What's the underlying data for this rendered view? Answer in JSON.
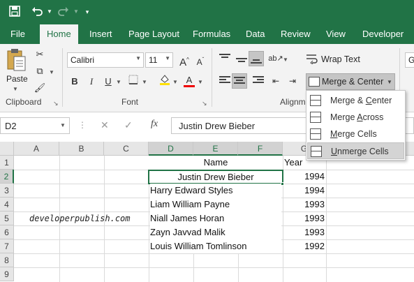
{
  "quick_access": {
    "save_icon": "save-icon",
    "undo_icon": "undo-icon",
    "redo_icon": "redo-icon",
    "customize_icon": "customize-icon"
  },
  "tabs": [
    "File",
    "Home",
    "Insert",
    "Page Layout",
    "Formulas",
    "Data",
    "Review",
    "View",
    "Developer"
  ],
  "active_tab": "Home",
  "ribbon": {
    "clipboard": {
      "paste_label": "Paste",
      "group_label": "Clipboard"
    },
    "font": {
      "font_name": "Calibri",
      "font_size": "11",
      "grow_label": "A",
      "shrink_label": "A",
      "bold": "B",
      "italic": "I",
      "underline": "U",
      "font_color_label": "A",
      "group_label": "Font"
    },
    "alignment": {
      "wrap_text": "Wrap Text",
      "merge_center": "Merge & Center",
      "group_label": "Alignm"
    },
    "number": {
      "format_value": "G"
    }
  },
  "formula_bar": {
    "name_box": "D2",
    "fx_label": "fx",
    "content": "Justin Drew Bieber"
  },
  "columns": [
    "A",
    "B",
    "C",
    "D",
    "E",
    "F",
    "G"
  ],
  "rows": [
    "1",
    "2",
    "3",
    "4",
    "5",
    "6",
    "7",
    "8",
    "9"
  ],
  "cells": {
    "name_header": "Name",
    "year_header": "Year",
    "data": [
      {
        "name": "Justin Drew Bieber",
        "year": "1994"
      },
      {
        "name": "Harry Edward Styles",
        "year": "1994"
      },
      {
        "name": "Liam William Payne",
        "year": "1993"
      },
      {
        "name": "Niall James Horan",
        "year": "1993"
      },
      {
        "name": "Zayn Javvad Malik",
        "year": "1993"
      },
      {
        "name": "Louis William Tomlinson",
        "year": "1992"
      }
    ],
    "watermark": "developerpublish.com"
  },
  "merge_menu": {
    "items": [
      {
        "pre": "Merge & ",
        "ul": "C",
        "post": "enter"
      },
      {
        "pre": "Merge ",
        "ul": "A",
        "post": "cross"
      },
      {
        "pre": "",
        "ul": "M",
        "post": "erge Cells"
      },
      {
        "pre": "",
        "ul": "U",
        "post": "nmerge Cells"
      }
    ],
    "highlighted": "Unmerge Cells"
  },
  "colors": {
    "brand": "#217346",
    "ribbon": "#f3f3f3"
  }
}
